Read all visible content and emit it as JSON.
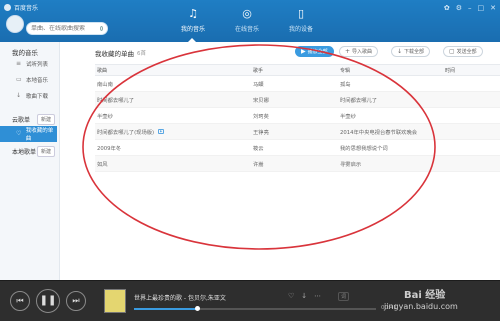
{
  "app": {
    "title": "百度音乐"
  },
  "search": {
    "placeholder": "单曲、在线歌曲搜索"
  },
  "nav": {
    "tabs": [
      {
        "label": "我的音乐",
        "icon": "music-note-icon"
      },
      {
        "label": "在线音乐",
        "icon": "globe-icon"
      },
      {
        "label": "我的设备",
        "icon": "phone-icon"
      }
    ]
  },
  "window_controls": [
    "skin-icon",
    "settings-icon",
    "minimize-icon",
    "maximize-icon",
    "close-icon"
  ],
  "sidebar": {
    "section_my_music": "我的音乐",
    "items": [
      {
        "label": "试听列表",
        "icon": "playlist-icon"
      },
      {
        "label": "本地音乐",
        "icon": "monitor-icon"
      },
      {
        "label": "歌曲下载",
        "icon": "download-icon"
      }
    ],
    "cloud_section": "云歌单",
    "cloud_new": "新建",
    "cloud_selected": "我收藏的单曲",
    "local_section": "本地歌单",
    "local_new": "新建"
  },
  "main": {
    "title": "我收藏的单曲",
    "count": "6首",
    "buttons": {
      "play_all": "播放全部",
      "import": "导入歌曲",
      "download_all": "下载全部",
      "send_all": "发送全部"
    },
    "columns": [
      "歌曲",
      "歌手",
      "专辑",
      "时间"
    ],
    "rows": [
      {
        "song": "南山南",
        "artist": "马頔",
        "album": "孤岛",
        "mv": false
      },
      {
        "song": "时间都去哪儿了",
        "artist": "宋贝娜",
        "album": "时间都去哪儿了",
        "mv": false
      },
      {
        "song": "半壶纱",
        "artist": "刘珂矣",
        "album": "半壶纱",
        "mv": false
      },
      {
        "song": "时间都去哪儿了(现场版)",
        "artist": "王铮亮",
        "album": "2014年中央电视台春节联欢晚会",
        "mv": true
      },
      {
        "song": "2009年冬",
        "artist": "筱云",
        "album": "我的思想我想说个词",
        "mv": false
      },
      {
        "song": "如风",
        "artist": "许嵩",
        "album": "寻雾启示",
        "mv": false
      }
    ]
  },
  "player": {
    "now_playing": "世界上最珍贵的歌 - 包贝尔,朱亚文",
    "time": "00:41",
    "lyric_btn": "词",
    "progress": 0.26
  },
  "watermark": {
    "line1": "Bai 经验",
    "line2": "jingyan.baidu.com"
  },
  "colors": {
    "topbar": "#1f7ec4",
    "accent": "#3a9be0",
    "annotation": "#d9343b"
  }
}
